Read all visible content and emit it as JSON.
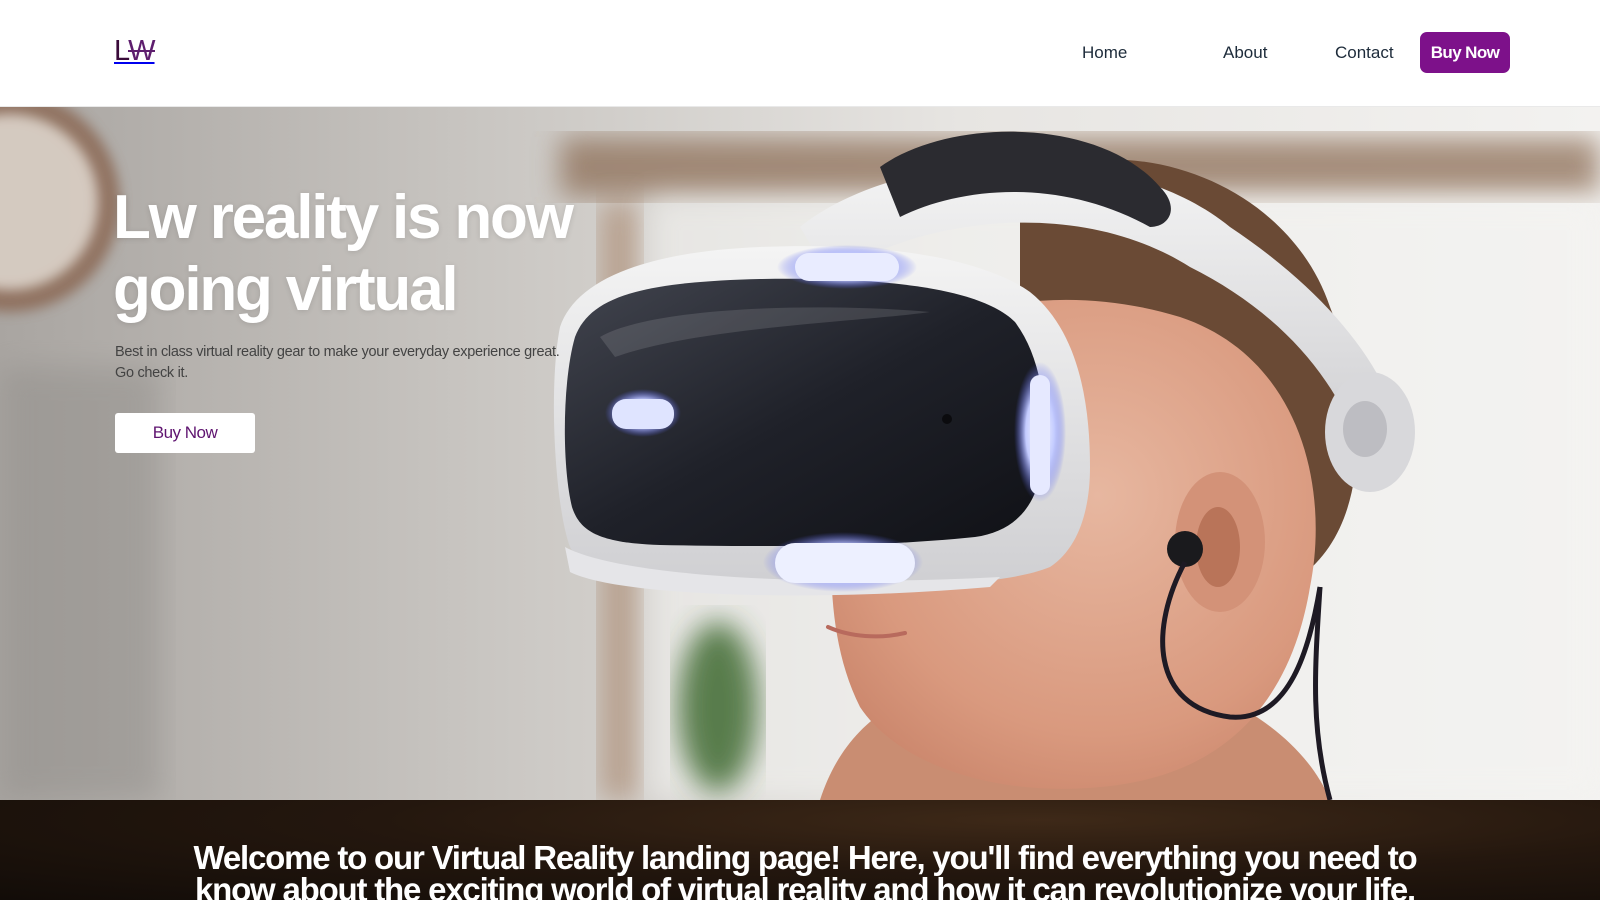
{
  "header": {
    "logo_letters": [
      "L",
      "W"
    ],
    "nav": {
      "home": "Home",
      "about": "About",
      "contact": "Contact",
      "buy_now": "Buy Now"
    }
  },
  "hero": {
    "title": "Lw reality is now going virtual",
    "subtitle": "Best in class virtual reality gear to make your everyday experience great. Go check it.",
    "cta_label": "Buy Now",
    "image": "boy-wearing-vr-headset"
  },
  "welcome": {
    "text": "Welcome to our Virtual Reality landing page! Here, you'll find everything you need to know about the exciting world of virtual reality and how it can revolutionize your life."
  },
  "colors": {
    "accent": "#7d118a",
    "logo": "#3a0a3a",
    "nav_text": "#1d2b3a",
    "hero_title": "#ffffff",
    "welcome_background": "#1c130c"
  }
}
